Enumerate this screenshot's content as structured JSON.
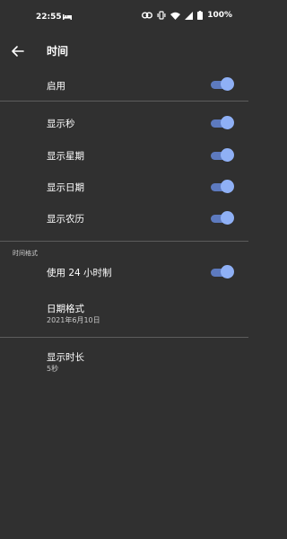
{
  "status_bar": {
    "time": "22:55",
    "battery_percent": "100%",
    "icons": [
      "bed-icon",
      "link-icon",
      "vibrate-icon",
      "wifi-icon",
      "signal-icon",
      "battery-icon"
    ]
  },
  "app_bar": {
    "title": "时间"
  },
  "settings": {
    "enable": {
      "label": "启用",
      "on": true
    },
    "show_seconds": {
      "label": "显示秒",
      "on": true
    },
    "show_weekday": {
      "label": "显示星期",
      "on": true
    },
    "show_date": {
      "label": "显示日期",
      "on": true
    },
    "show_lunar": {
      "label": "显示农历",
      "on": true
    },
    "time_format_header": "时间格式",
    "use_24h": {
      "label": "使用 24 小时制",
      "on": true
    },
    "date_format": {
      "label": "日期格式",
      "value": "2021年6月10日"
    },
    "display_duration": {
      "label": "显示时长",
      "value": "5秒"
    }
  },
  "colors": {
    "background": "#303030",
    "switch_track": "#5d7abf",
    "switch_thumb": "#8fb0f5",
    "divider": "#5c5c5c"
  }
}
